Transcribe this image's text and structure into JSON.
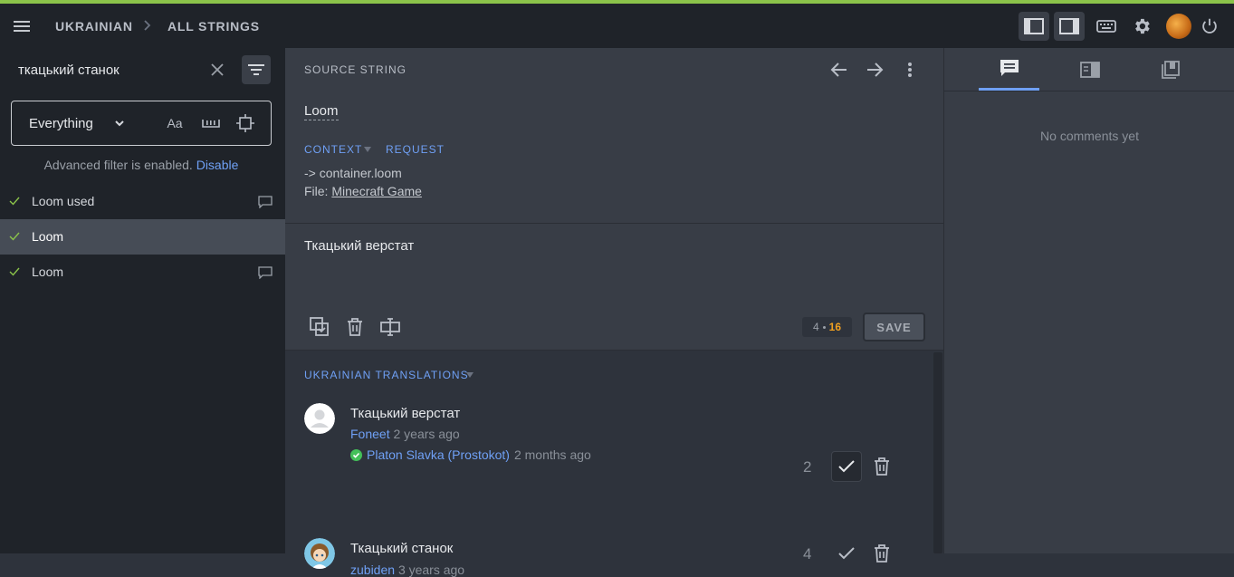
{
  "header": {
    "breadcrumb": [
      "UKRAINIAN",
      "ALL STRINGS"
    ]
  },
  "sidebar": {
    "search_value": "ткацький станок",
    "filter": {
      "selected": "Everything",
      "case_label": "Aa"
    },
    "advanced_filter_text": "Advanced filter is enabled.",
    "advanced_filter_link": "Disable",
    "items": [
      {
        "label": "Loom used",
        "has_comment": true,
        "selected": false
      },
      {
        "label": "Loom",
        "has_comment": false,
        "selected": true
      },
      {
        "label": "Loom",
        "has_comment": true,
        "selected": false
      }
    ]
  },
  "source": {
    "heading": "SOURCE STRING",
    "text": "Loom",
    "context_label": "CONTEXT",
    "request_label": "REQUEST",
    "key": "-> container.loom",
    "file_prefix": "File:",
    "file_name": "Minecraft Game"
  },
  "translation": {
    "value": "Ткацький верстат",
    "counter_current": "4",
    "counter_max": "16",
    "save_label": "SAVE"
  },
  "history": {
    "heading": "UKRAINIAN TRANSLATIONS",
    "entries": [
      {
        "text": "Ткацький верстат",
        "author": "Foneet",
        "time": "2 years ago",
        "approver": "Platon Slavka (Prostokot)",
        "approved_time": "2 months ago",
        "votes": "2"
      },
      {
        "text": "Ткацький станок",
        "author": "zubiden",
        "time": "3 years ago",
        "votes": "4"
      }
    ]
  },
  "comments": {
    "empty_text": "No comments yet"
  },
  "colors": {
    "accent": "#8bc34a",
    "link": "#6fa0f5",
    "counter_max": "#f0a020"
  }
}
